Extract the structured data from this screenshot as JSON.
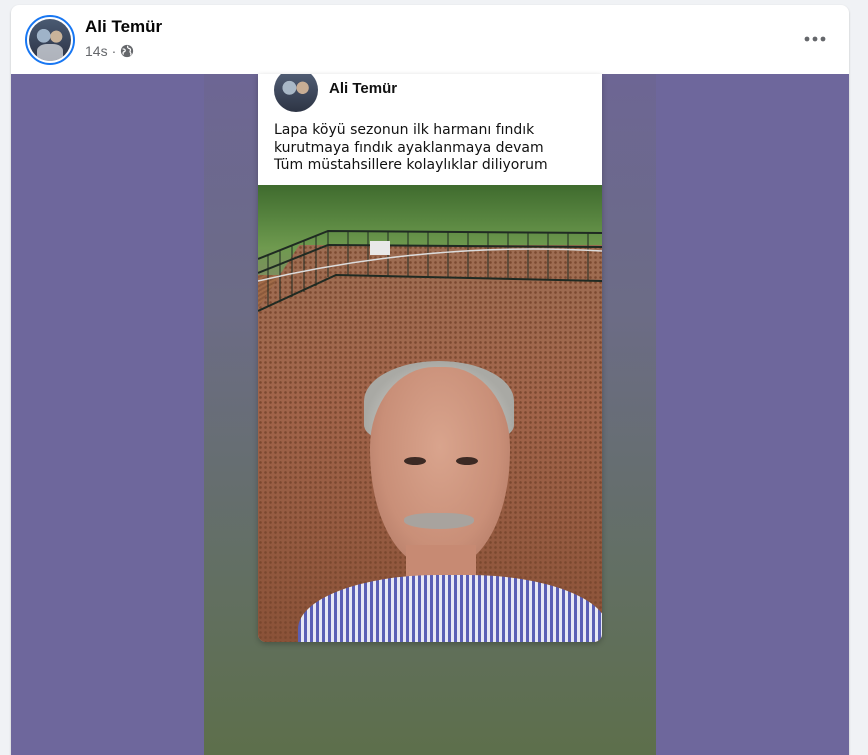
{
  "post": {
    "author_name": "Ali Temür",
    "time": "14s",
    "separator": "·",
    "audience_icon": "globe-icon",
    "more_icon": "more-horizontal-icon"
  },
  "story": {
    "author_name": "Ali Temür",
    "text_lines": [
      "Lapa köyü sezonun ilk harmanı fındık",
      "kurutmaya fındık ayaklanmaya devam",
      "Tüm müstahsillere kolaylıklar diliyorum"
    ]
  },
  "colors": {
    "media_background": "#6e679c",
    "accent": "#1877f2"
  }
}
